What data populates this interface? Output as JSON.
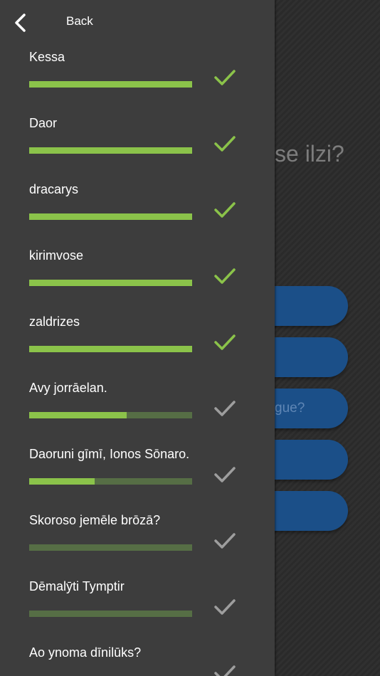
{
  "background": {
    "question_fragment": "se ilzi?",
    "answer_buttons": [
      {
        "label": ""
      },
      {
        "label": ""
      },
      {
        "label": "gue?"
      },
      {
        "label": ""
      },
      {
        "label": ""
      }
    ]
  },
  "drawer": {
    "back_label": "Back",
    "items": [
      {
        "label": "Kessa",
        "progress": 1.0,
        "complete": true
      },
      {
        "label": "Daor",
        "progress": 1.0,
        "complete": true
      },
      {
        "label": "dracarys",
        "progress": 1.0,
        "complete": true
      },
      {
        "label": "kirimvose",
        "progress": 1.0,
        "complete": true
      },
      {
        "label": "zaldrizes",
        "progress": 1.0,
        "complete": true
      },
      {
        "label": "Avy jorrāelan.",
        "progress": 0.6,
        "complete": false
      },
      {
        "label": "Daoruni gīmī, Ionos Sōnaro.",
        "progress": 0.4,
        "complete": false
      },
      {
        "label": "Skoroso jemēle brōzā?",
        "progress": 0.0,
        "complete": false
      },
      {
        "label": "Dēmalȳti Tymptir",
        "progress": 0.0,
        "complete": false
      },
      {
        "label": "Ao ynoma dīnilūks?",
        "progress": 0.0,
        "complete": false
      }
    ]
  },
  "colors": {
    "drawer_bg": "#3d3d3d",
    "progress_fill": "#8bc34a",
    "progress_track": "#566e45",
    "check_complete": "#8bc34a",
    "check_incomplete": "#9e9e9e",
    "button_blue": "#1b4f88"
  },
  "icons": {
    "back": "chevron-left-icon",
    "status": "checkmark-icon"
  }
}
